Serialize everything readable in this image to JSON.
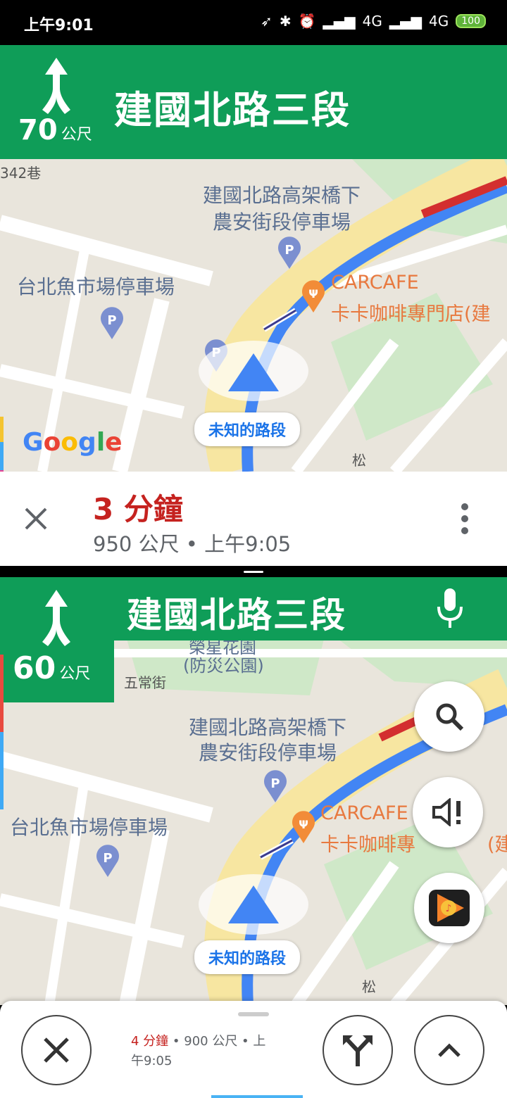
{
  "status_bar": {
    "time": "上午9:01",
    "network1": "4G",
    "network2": "4G",
    "battery": "100"
  },
  "top_nav": {
    "street": "建國北路三段",
    "distance_value": "70",
    "distance_unit": "公尺",
    "maneuver_icon": "keep-straight-fork-icon"
  },
  "top_map": {
    "labels": {
      "parking_a_line1": "建國北路高架橋下",
      "parking_a_line2": "農安街段停車場",
      "parking_b": "台北魚市場停車場",
      "poi_line1": "CARCAFE",
      "poi_line2": "卡卡咖啡專門店(建",
      "lane_top": "342巷",
      "road_bottom": "松"
    },
    "unknown_road": "未知的路段",
    "logo": "Google"
  },
  "top_eta": {
    "minutes": "3 分鐘",
    "details": "950 公尺 • 上午9:05"
  },
  "bottom_nav": {
    "street": "建國北路三段",
    "distance_value": "60",
    "distance_unit": "公尺",
    "maneuver_icon": "keep-straight-fork-icon",
    "mic_icon": "microphone-icon"
  },
  "bottom_map": {
    "labels": {
      "park_line1": "榮星花園",
      "park_line2": "(防災公園)",
      "road_wuchang": "五常街",
      "parking_a_line1": "建國北路高架橋下",
      "parking_a_line2": "農安街段停車場",
      "parking_b": "台北魚市場停車場",
      "poi_line1": "CARCAFE",
      "poi_line2": "卡卡咖啡專",
      "poi_line2_tail": "(建",
      "road_bottom": "松"
    },
    "unknown_road": "未知的路段"
  },
  "bottom_eta": {
    "minutes": "4 分鐘",
    "details_line1": " • 900 公尺 • 上",
    "details_line2": "午9:05"
  },
  "colors": {
    "nav_green": "#0f9d58",
    "eta_red": "#c5221f",
    "route_blue": "#4285f4",
    "traffic_red": "#d32f2f"
  }
}
